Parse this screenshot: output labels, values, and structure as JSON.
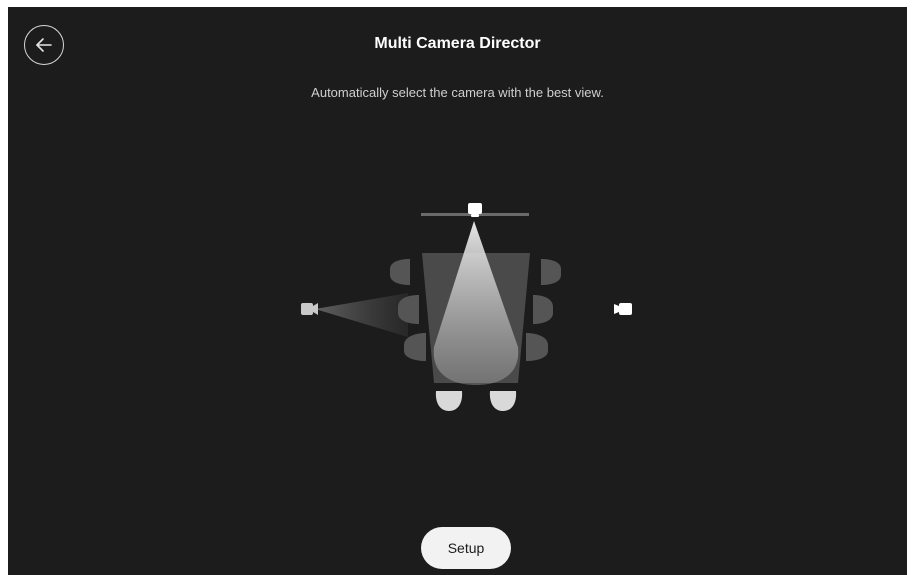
{
  "header": {
    "title": "Multi Camera Director",
    "subtitle": "Automatically select the camera with the best view.",
    "back_icon": "arrow-left-icon"
  },
  "illustration": {
    "icons": [
      "top-camera-icon",
      "left-camera-icon",
      "right-camera-icon"
    ],
    "active_camera": "top-camera"
  },
  "actions": {
    "setup_label": "Setup"
  },
  "colors": {
    "background": "#1c1c1c",
    "text": "#ffffff",
    "button_bg": "#f2f2f2"
  }
}
